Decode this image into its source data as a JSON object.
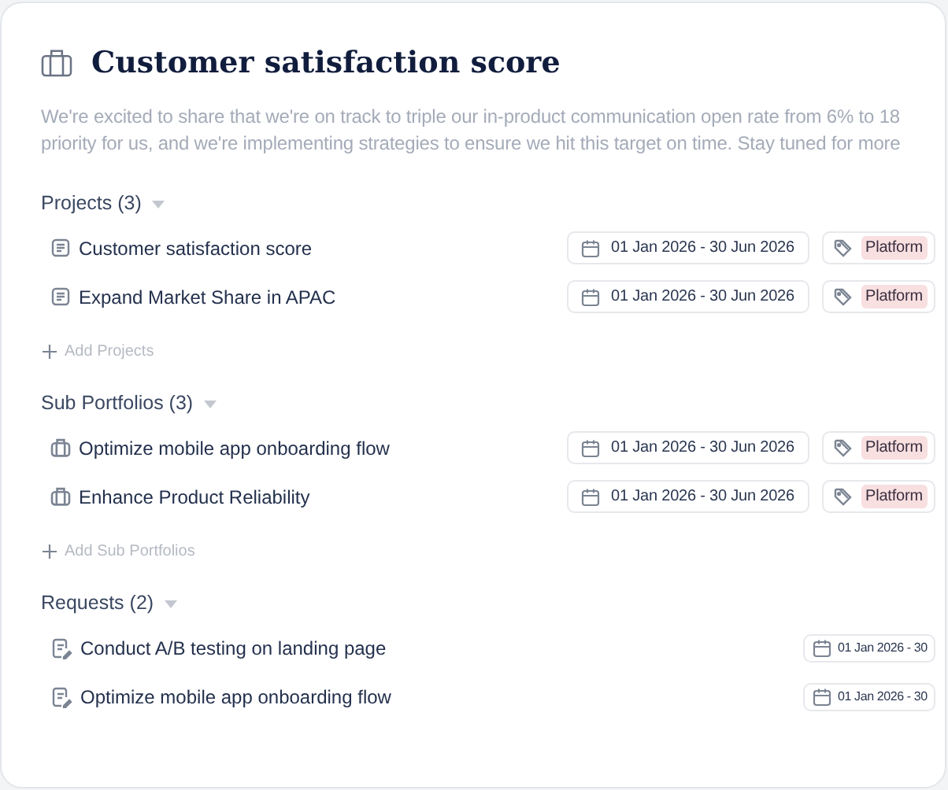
{
  "title": "Customer satisfaction score",
  "description_lines": [
    "We're excited to share that we're on track to triple our in-product communication open rate from 6% to 18",
    "priority for us, and we're implementing strategies to ensure we hit this target on time.  Stay tuned for more"
  ],
  "sections": [
    {
      "kind": "projects",
      "heading": "Projects (3)",
      "expanded": true,
      "items": [
        {
          "name": "Customer satisfaction score",
          "dates": "01 Jan 2026 - 30 Jun 2026",
          "tag": "Platform"
        },
        {
          "name": "Expand Market Share in APAC",
          "dates": "01 Jan 2026 - 30 Jun 2026",
          "tag": "Platform"
        }
      ],
      "add_label": "Add Projects"
    },
    {
      "kind": "portfolios",
      "heading": "Sub Portfolios (3)",
      "expanded": true,
      "items": [
        {
          "name": "Optimize mobile app onboarding flow",
          "dates": "01 Jan 2026 - 30 Jun 2026",
          "tag": "Platform"
        },
        {
          "name": "Enhance Product Reliability",
          "dates": "01 Jan 2026 - 30 Jun 2026",
          "tag": "Platform"
        }
      ],
      "add_label": "Add Sub Portfolios"
    },
    {
      "kind": "requests",
      "heading": "Requests (2)",
      "expanded": true,
      "items": [
        {
          "name": "Conduct A/B testing on landing page",
          "dates": "01 Jan 2026 - 30"
        },
        {
          "name": "Optimize mobile app onboarding flow",
          "dates": "01 Jan 2026 - 30"
        }
      ]
    }
  ]
}
